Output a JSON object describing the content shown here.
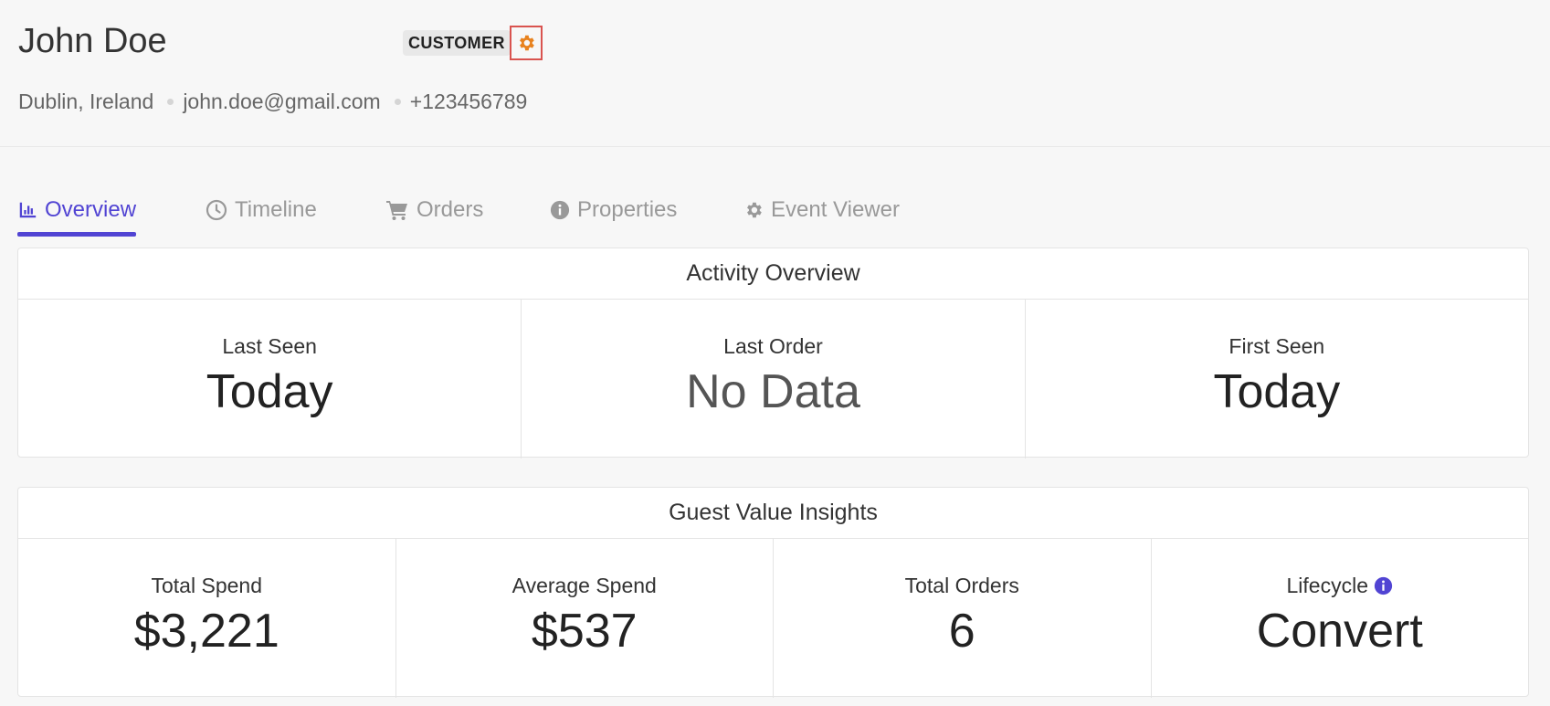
{
  "profile": {
    "name": "John Doe",
    "badge": "CUSTOMER",
    "location": "Dublin, Ireland",
    "email": "john.doe@gmail.com",
    "phone": "+123456789"
  },
  "tabs": [
    {
      "label": "Overview",
      "icon": "chart-bar-icon",
      "active": true
    },
    {
      "label": "Timeline",
      "icon": "clock-icon"
    },
    {
      "label": "Orders",
      "icon": "cart-icon"
    },
    {
      "label": "Properties",
      "icon": "info-circle-icon"
    },
    {
      "label": "Event Viewer",
      "icon": "gear-icon"
    }
  ],
  "activity": {
    "title": "Activity Overview",
    "stats": [
      {
        "label": "Last Seen",
        "value": "Today"
      },
      {
        "label": "Last Order",
        "value": "No Data"
      },
      {
        "label": "First Seen",
        "value": "Today"
      }
    ]
  },
  "insights": {
    "title": "Guest Value Insights",
    "stats": [
      {
        "label": "Total Spend",
        "value": "$3,221"
      },
      {
        "label": "Average Spend",
        "value": "$537"
      },
      {
        "label": "Total Orders",
        "value": "6"
      },
      {
        "label": "Lifecycle",
        "value": "Convert",
        "has_info": true
      }
    ]
  },
  "colors": {
    "accent": "#5144d3",
    "gear": "#e8821e",
    "highlight_border": "#d9534f"
  }
}
